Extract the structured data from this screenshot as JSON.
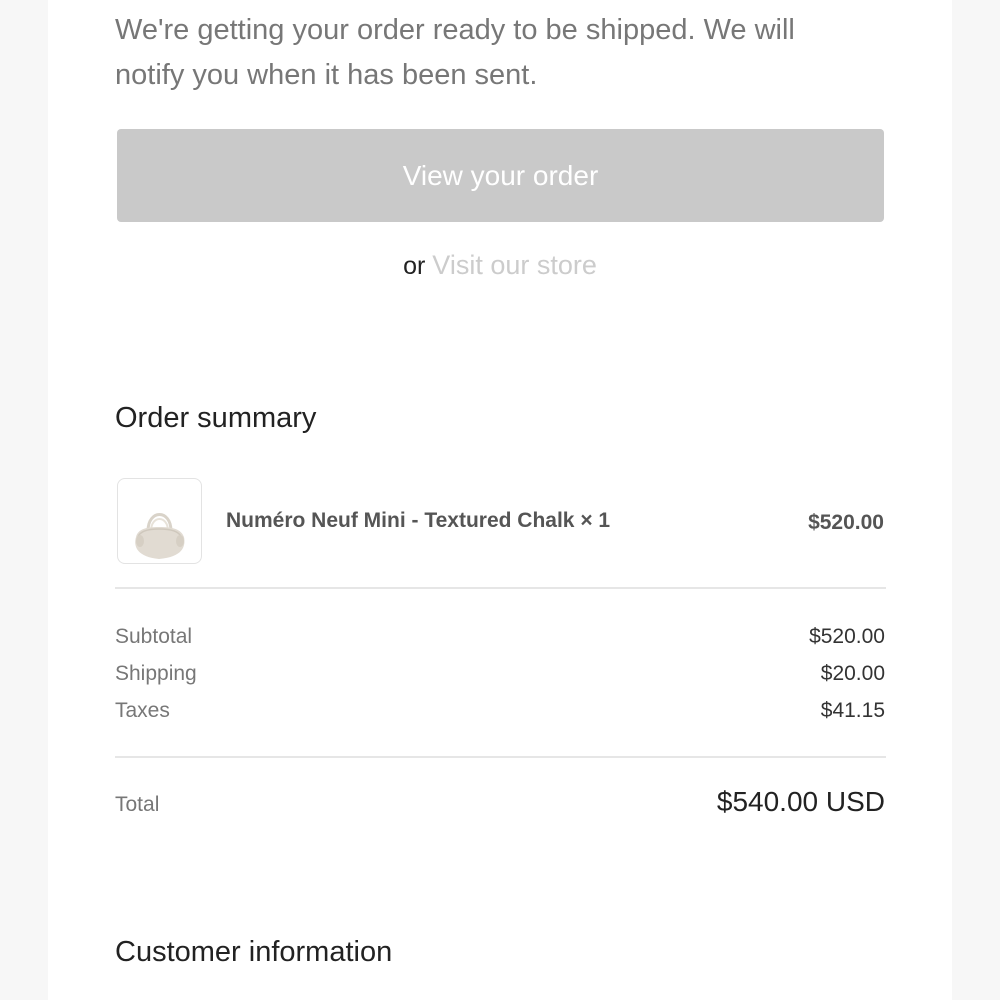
{
  "intro": {
    "line1": "We're getting your order ready to be shipped. We will",
    "line2": "notify you when it has been sent."
  },
  "actions": {
    "view_order_label": "View your order",
    "or_text": "or",
    "visit_store_label": "Visit our store"
  },
  "order_summary": {
    "title": "Order summary",
    "items": [
      {
        "name": "Numéro Neuf Mini - Textured Chalk × 1",
        "price": "$520.00",
        "thumbnail_icon": "handbag-icon"
      }
    ],
    "lines": [
      {
        "label": "Subtotal",
        "value": "$520.00"
      },
      {
        "label": "Shipping",
        "value": "$20.00"
      },
      {
        "label": "Taxes",
        "value": "$41.15"
      }
    ],
    "total_label": "Total",
    "total_value": "$540.00 USD"
  },
  "customer_information": {
    "title": "Customer information"
  },
  "colors": {
    "button_bg": "#c9c9c9",
    "link_color": "#cccccc",
    "muted_text": "#777777",
    "primary_text": "#222222"
  }
}
